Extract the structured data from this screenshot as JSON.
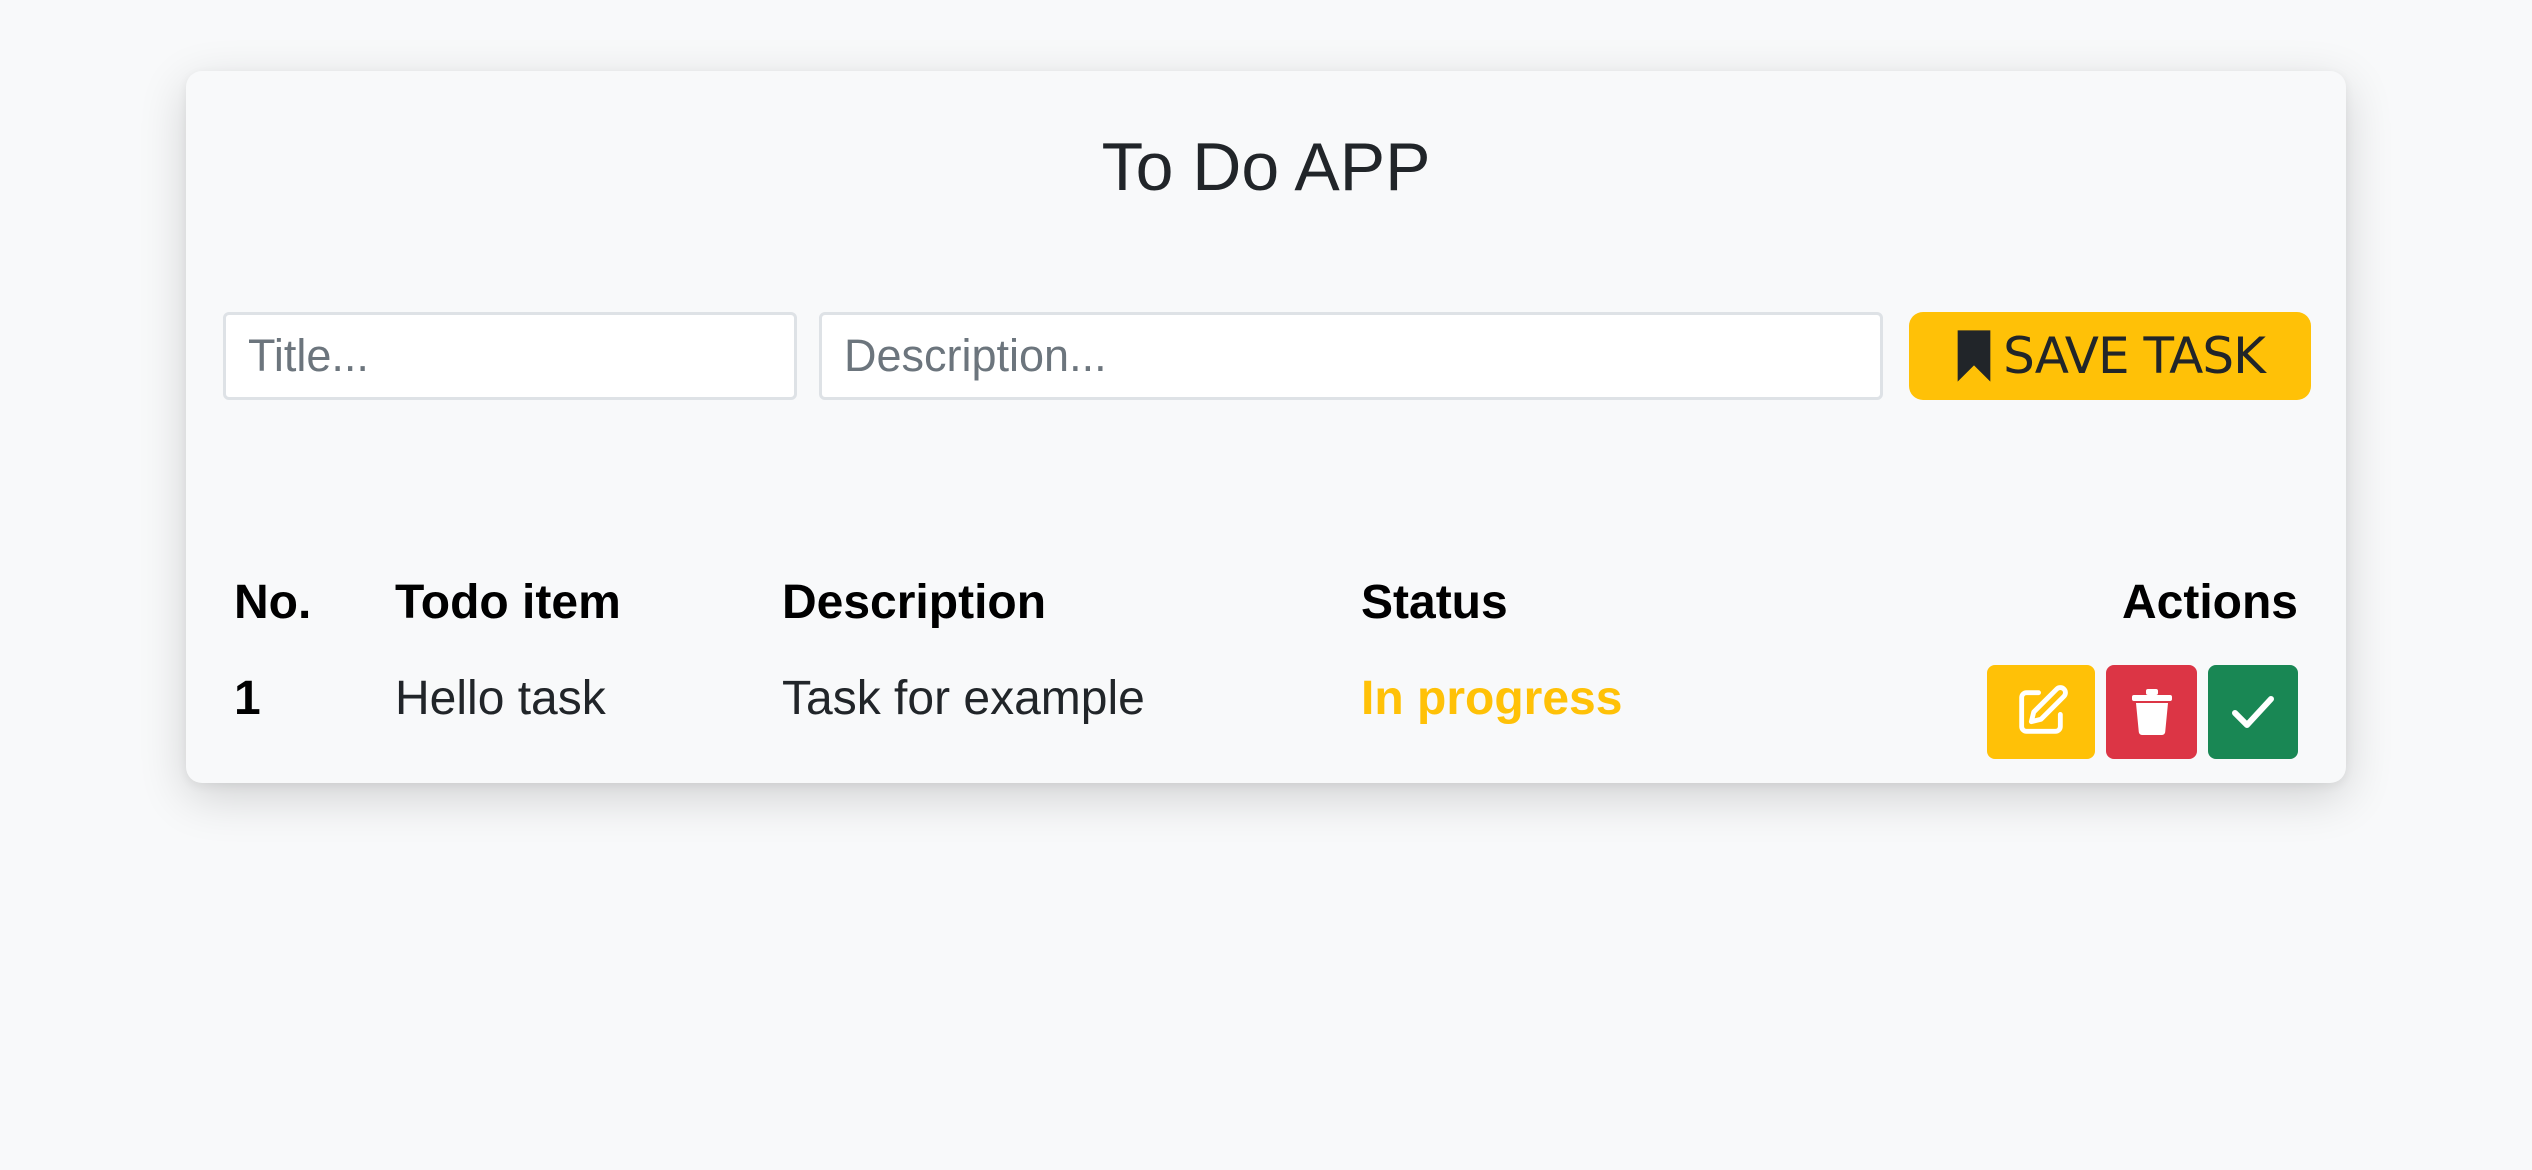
{
  "app": {
    "title": "To Do APP"
  },
  "form": {
    "title_placeholder": "Title...",
    "title_value": "",
    "description_placeholder": "Description...",
    "description_value": "",
    "save_label": "SAVE TASK",
    "save_icon": "bookmark-icon"
  },
  "table": {
    "headers": {
      "no": "No.",
      "item": "Todo item",
      "description": "Description",
      "status": "Status",
      "actions": "Actions"
    },
    "rows": [
      {
        "no": "1",
        "item": "Hello task",
        "description": "Task for example",
        "status": "In progress",
        "actions": [
          "pencil-square-icon",
          "trash-icon",
          "check-icon"
        ]
      }
    ]
  },
  "colors": {
    "warning": "#ffc107",
    "danger": "#dc3545",
    "success": "#198754",
    "background": "#f8f9fa"
  }
}
